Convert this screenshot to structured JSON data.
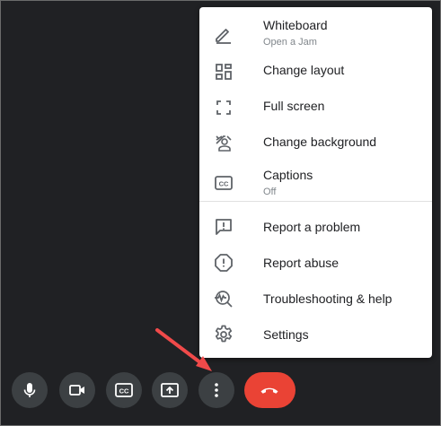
{
  "menu": {
    "whiteboard": {
      "label": "Whiteboard",
      "sub": "Open a Jam",
      "icon": "pencil-icon"
    },
    "change_layout": {
      "label": "Change layout",
      "icon": "layout-icon"
    },
    "full_screen": {
      "label": "Full screen",
      "icon": "fullscreen-icon"
    },
    "change_background": {
      "label": "Change background",
      "icon": "background-icon"
    },
    "captions": {
      "label": "Captions",
      "sub": "Off",
      "icon": "cc-icon"
    },
    "report_problem": {
      "label": "Report a problem",
      "icon": "feedback-icon"
    },
    "report_abuse": {
      "label": "Report abuse",
      "icon": "report-icon"
    },
    "troubleshooting": {
      "label": "Troubleshooting & help",
      "icon": "troubleshoot-icon"
    },
    "settings": {
      "label": "Settings",
      "icon": "gear-icon"
    }
  },
  "toolbar": {
    "buttons": [
      "microphone-icon",
      "camera-icon",
      "captions-icon",
      "present-icon",
      "more-options-icon"
    ],
    "end_call": "end-call-icon"
  },
  "colors": {
    "background": "#202124",
    "button": "#3c4043",
    "end_call": "#ea4335",
    "arrow": "#f04a4a",
    "menu_text": "#202124",
    "menu_subtext": "#80868b"
  }
}
